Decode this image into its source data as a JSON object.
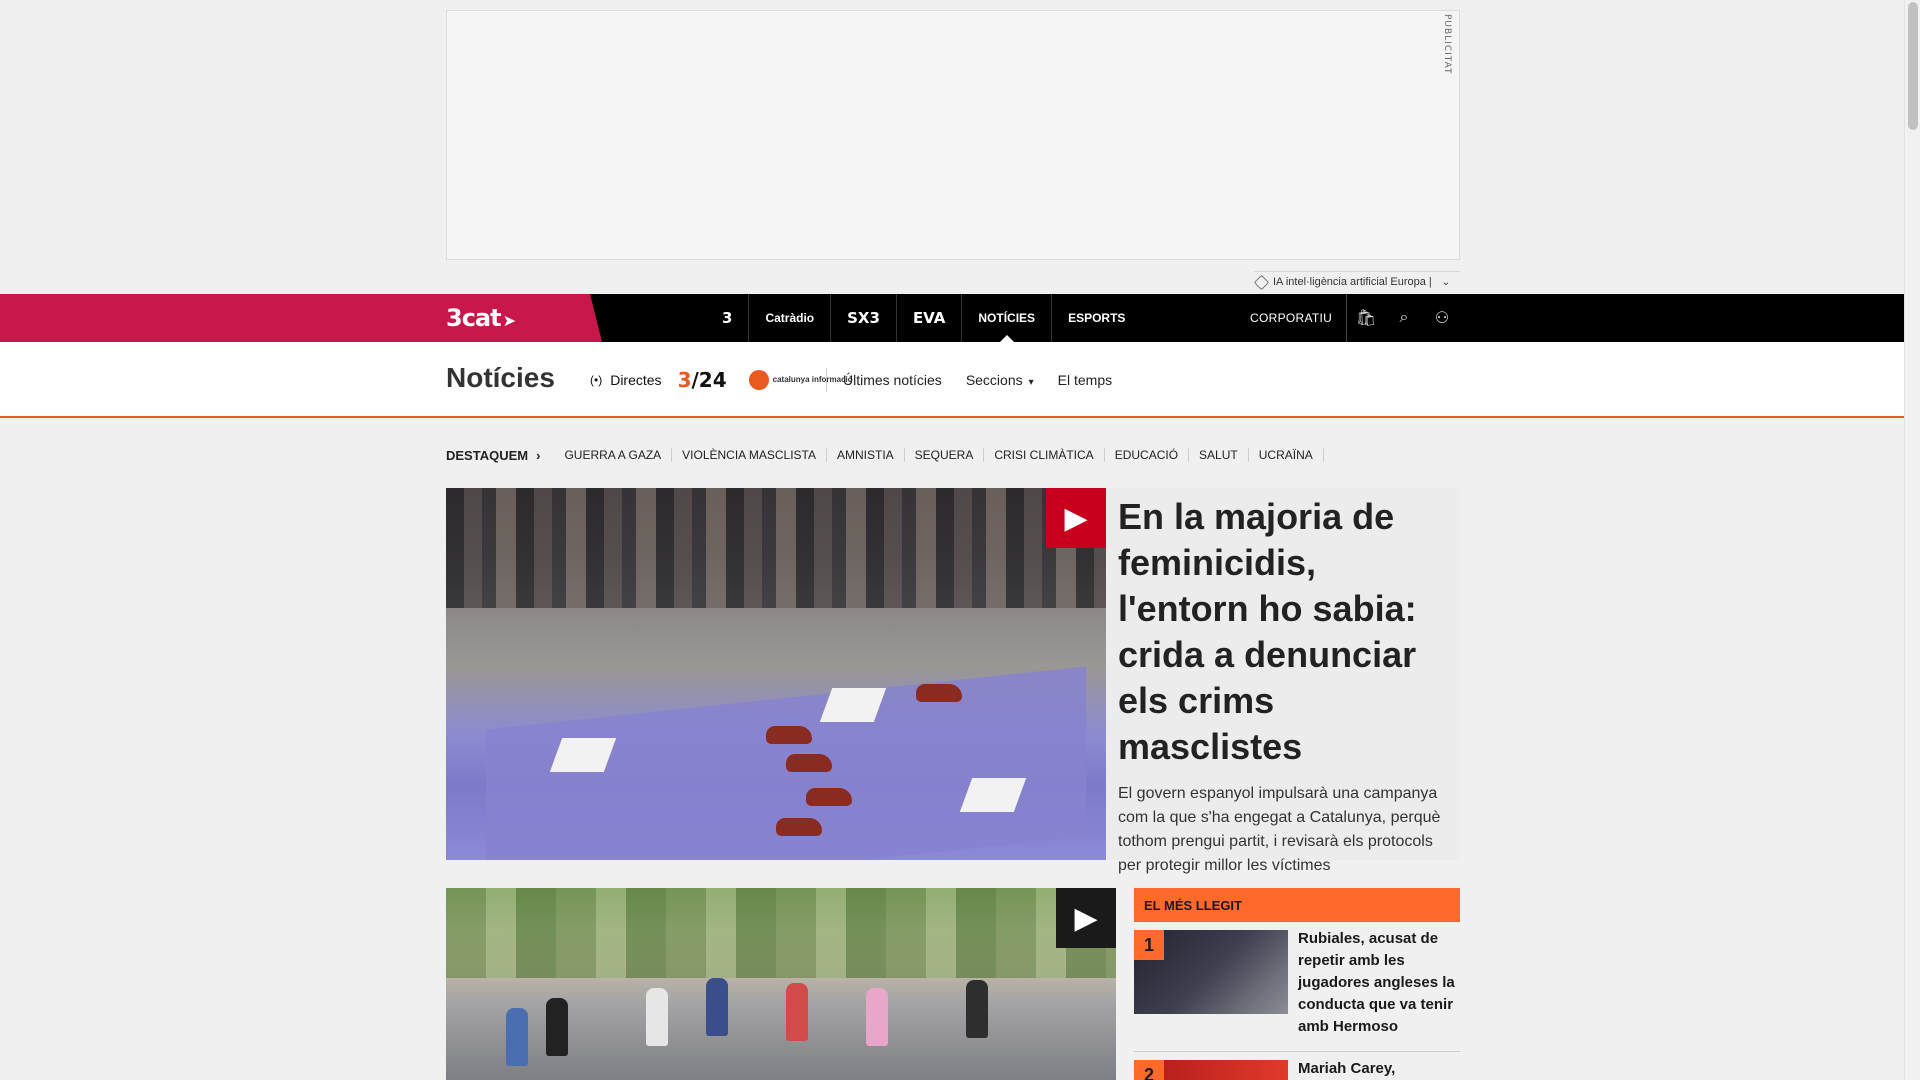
{
  "ad": {
    "label": "PUBLICITAT"
  },
  "ai_tag": {
    "text": "IA intel·ligència artificial Europa |"
  },
  "topbar": {
    "brand": "3cat",
    "channels": [
      "3",
      "Catràdio",
      "SX3",
      "EVA",
      "NOTÍCIES",
      "ESPORTS"
    ],
    "corporate": "CORPORATIU"
  },
  "section": {
    "title": "Notícies",
    "live_label": "Directes",
    "logo_324": "3/24",
    "logo_catinfo": "catalunya informació",
    "links": [
      "Últimes notícies",
      "Seccions",
      "El temps"
    ]
  },
  "featured": {
    "heading": "DESTAQUEM",
    "tags": [
      "GUERRA A GAZA",
      "VIOLÈNCIA MASCLISTA",
      "AMNISTIA",
      "SEQUERA",
      "CRISI CLIMÀTICA",
      "EDUCACIÓ",
      "SALUT",
      "UCRAÏNA"
    ]
  },
  "hero": {
    "title": "En la majoria de feminicidis, l'entorn ho sabia: crida a denunciar els crims masclistes",
    "summary": "El govern espanyol impulsarà una campanya com la que s'ha engegat a Catalunya, perquè tothom prengui partit, i revisarà els protocols per protegir millor les víctimes"
  },
  "most_read": {
    "heading": "EL MÉS LLEGIT",
    "items": [
      {
        "rank": "1",
        "title": "Rubiales, acusat de repetir amb les jugadores angleses la conducta que va tenir amb Hermoso"
      },
      {
        "rank": "2",
        "title": "Mariah Carey,"
      }
    ]
  },
  "colors": {
    "brand_red": "#c8184b",
    "accent_orange": "#ff6a2b",
    "play_red": "#c8001e"
  }
}
